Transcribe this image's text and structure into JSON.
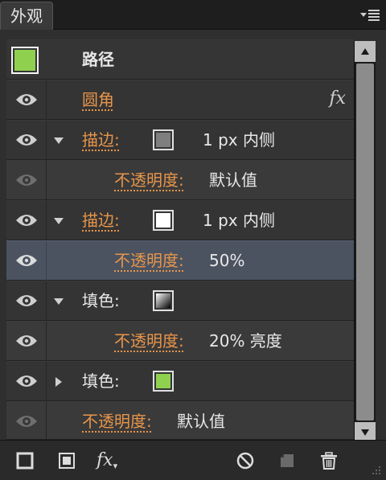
{
  "panel": {
    "tab_title": "外观"
  },
  "rows": [
    {
      "id": "path",
      "label": "路径"
    },
    {
      "id": "rounded",
      "label": "圆角",
      "fx": "fx"
    },
    {
      "id": "stroke1",
      "label": "描边:",
      "value": "1 px  内侧",
      "swatch_color": "#7f7f7f"
    },
    {
      "id": "stroke1_opacity",
      "label": "不透明度:",
      "value": "默认值"
    },
    {
      "id": "stroke2",
      "label": "描边:",
      "value": "1 px  内侧",
      "swatch_color": "#ffffff"
    },
    {
      "id": "stroke2_opacity",
      "label": "不透明度:",
      "value": "50%"
    },
    {
      "id": "fill1",
      "label": "填色:",
      "swatch": "gradient"
    },
    {
      "id": "fill1_opacity",
      "label": "不透明度:",
      "value": "20% 亮度"
    },
    {
      "id": "fill2",
      "label": "填色:",
      "swatch_color": "#8fd14f"
    },
    {
      "id": "object_opacity",
      "label": "不透明度:",
      "value": "默认值"
    }
  ],
  "colors": {
    "accent_link": "#e8954a",
    "selected_row": "#4b5361",
    "thumb_green": "#8fd14f"
  },
  "footer": {
    "fx_label": "fx"
  }
}
